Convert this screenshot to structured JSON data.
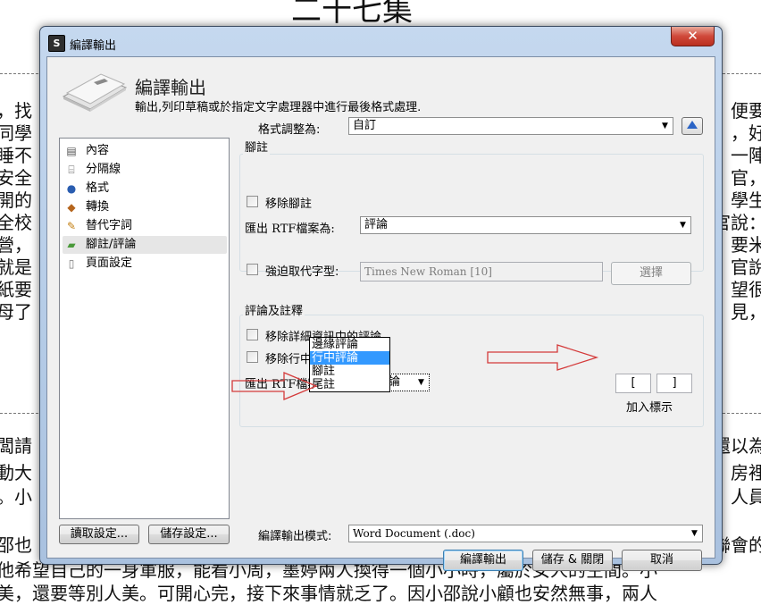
{
  "background": {
    "top_heading": "二十七集",
    "left_lines": [
      "，找",
      "同學",
      "睡不",
      "安全",
      "開的",
      "全校",
      "營，",
      "就是",
      "紙要",
      "母了"
    ],
    "right_lines": [
      "，便要",
      "，好",
      "一陣",
      "官，",
      "學生",
      "官說：",
      "要米",
      "官說",
      "望很",
      "見，"
    ],
    "lower_left": [
      "闆請",
      "動大",
      "。小",
      "邵也"
    ],
    "lower_right": [
      "還以為",
      "房裡",
      "人員",
      "聯會的"
    ],
    "bottom_line_1": "他希望自己的一身軍服，能看小周，墨婷兩人換得一個小小時，屬於女人的空間。小",
    "bottom_line_2": "美，還要等別人美。可開心完，接下來事情就乏了。因小邵說小顧也安然無事，兩人"
  },
  "window": {
    "title": "編譯輸出",
    "close_label": "✕",
    "header_title": "編譯輸出",
    "header_subtitle": "輸出,列印草稿或於指定文字處理器中進行最後格式處理."
  },
  "format": {
    "label": "格式調整為:",
    "value": "自訂"
  },
  "sidebar": {
    "items": [
      {
        "label": "內容",
        "icon": "document-icon"
      },
      {
        "label": "分隔線",
        "icon": "separator-icon"
      },
      {
        "label": "格式",
        "icon": "format-icon"
      },
      {
        "label": "轉換",
        "icon": "convert-icon"
      },
      {
        "label": "替代字詞",
        "icon": "replace-words-icon"
      },
      {
        "label": "腳註/評論",
        "icon": "footnote-comment-icon"
      },
      {
        "label": "頁面設定",
        "icon": "page-setup-icon"
      }
    ],
    "selected_index": 5
  },
  "footnotes": {
    "group_title": "腳註",
    "remove_label": "移除腳註",
    "export_label": "匯出 RTF檔案為:",
    "export_value": "評論",
    "force_font_label": "強迫取代字型:",
    "font_value": "Times New Roman [10]",
    "choose_label": "選擇"
  },
  "comments": {
    "group_title": "評論及註釋",
    "remove_inspector_label": "移除詳細資訊中的評論",
    "remove_inline_label": "移除行中註釋",
    "export_label": "匯出 RTF檔案為:",
    "export_value": "行中評論",
    "options": [
      "邊緣評論",
      "行中評論",
      "腳註",
      "尾註"
    ],
    "highlighted_index": 1,
    "open_bracket": "[",
    "close_bracket": "]",
    "markers_label": "加入標示"
  },
  "bottom": {
    "load_label": "讀取設定...",
    "save_label": "儲存設定...",
    "mode_label": "編譯輸出模式:",
    "mode_value": "Word Document (.doc)",
    "compile_label": "編譯輸出",
    "save_close_label": "儲存 & 關閉",
    "cancel_label": "取消"
  },
  "colors": {
    "highlight": "#3399ff",
    "annotation_arrow": "#d43a3a"
  }
}
